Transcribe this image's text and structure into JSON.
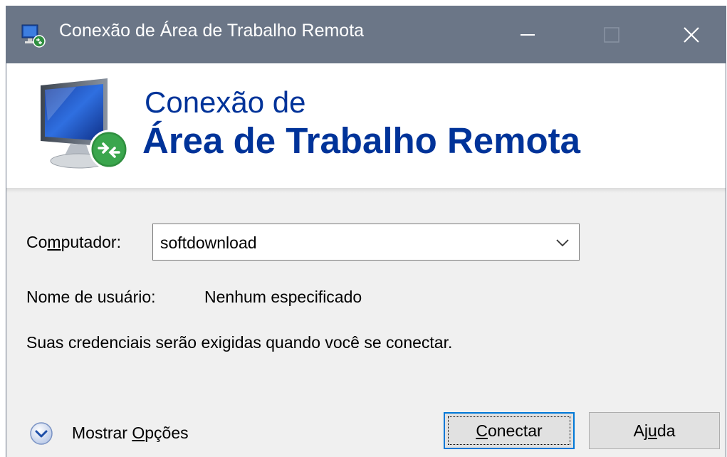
{
  "window": {
    "title": "Conexão de Área de Trabalho Remota",
    "icon": "remote-desktop-app-icon",
    "controls": [
      "minimize-icon",
      "maximize-icon",
      "close-icon"
    ]
  },
  "banner": {
    "line1": "Conexão de",
    "line2": "Área de Trabalho Remota",
    "icon": "remote-desktop-monitor-icon"
  },
  "form": {
    "computer_label_pre": "Co",
    "computer_label_mnemonic": "m",
    "computer_label_post": "putador:",
    "computer_value": "softdownload",
    "username_label": "Nome de usuário:",
    "username_value": "Nenhum especificado",
    "credentials_note": "Suas credenciais serão exigidas quando você se conectar."
  },
  "footer": {
    "options_pre": "Mostrar ",
    "options_mnemonic": "O",
    "options_post": "pções",
    "connect_mnemonic": "C",
    "connect_post": "onectar",
    "help_pre": "Aj",
    "help_mnemonic": "u",
    "help_post": "da"
  },
  "colors": {
    "titlebar": "#6b7687",
    "banner_text": "#003399",
    "focus_border": "#0078d7"
  }
}
